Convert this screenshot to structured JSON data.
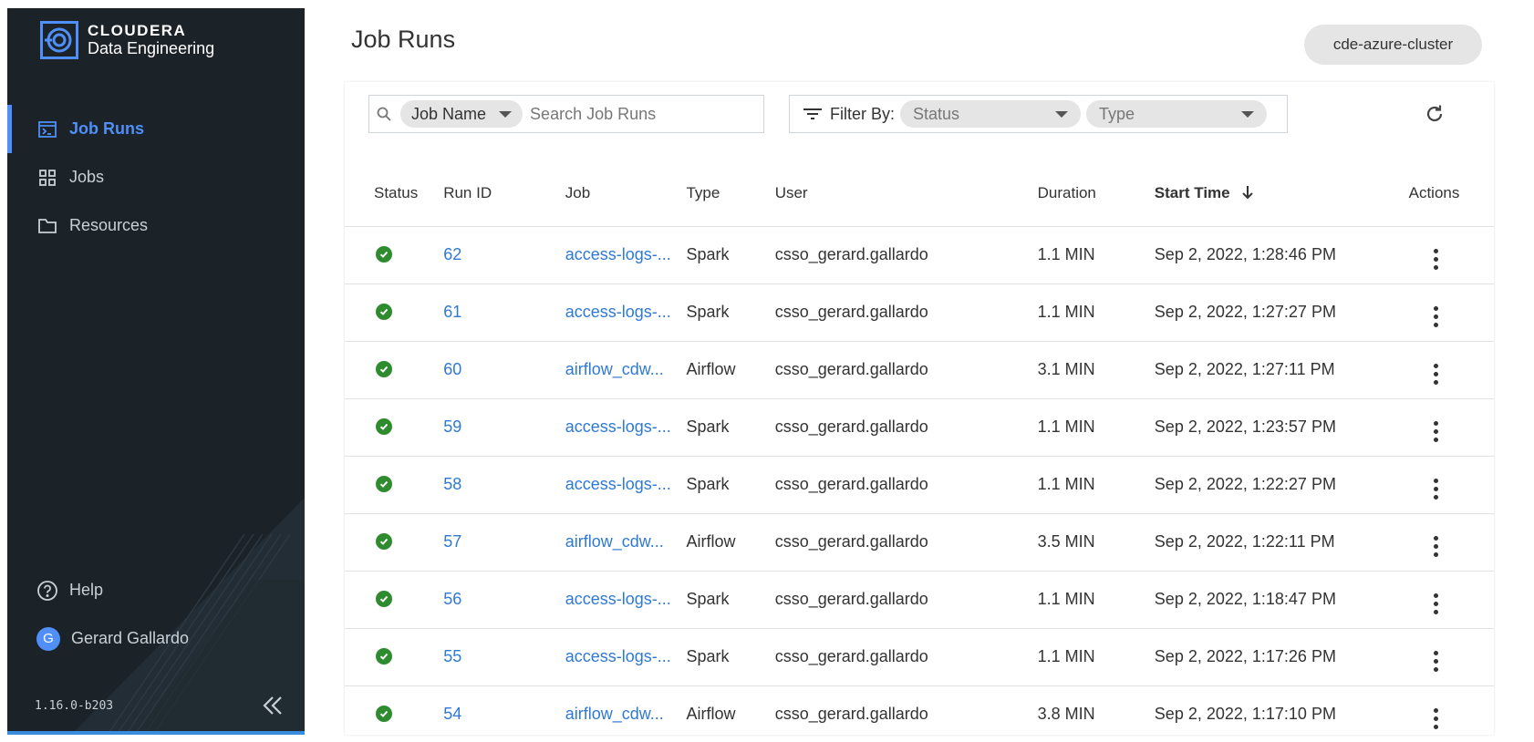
{
  "brand": {
    "line1": "CLOUDERA",
    "line2": "Data Engineering"
  },
  "sidebar": {
    "items": [
      {
        "label": "Job Runs",
        "icon": "job-runs-icon",
        "active": true
      },
      {
        "label": "Jobs",
        "icon": "grid-icon",
        "active": false
      },
      {
        "label": "Resources",
        "icon": "folder-icon",
        "active": false
      }
    ],
    "help_label": "Help",
    "user": {
      "initial": "G",
      "name": "Gerard Gallardo"
    },
    "version": "1.16.0-b203",
    "accent_color": "#4f8ff7",
    "background_color": "#1b2329"
  },
  "header": {
    "title": "Job Runs",
    "cluster": "cde-azure-cluster"
  },
  "toolbar": {
    "search_field": "Job Name",
    "search_placeholder": "Search Job Runs",
    "filter_label": "Filter By:",
    "status_placeholder": "Status",
    "type_placeholder": "Type"
  },
  "table": {
    "headers": {
      "status": "Status",
      "run_id": "Run ID",
      "job": "Job",
      "type": "Type",
      "user": "User",
      "duration": "Duration",
      "start_time": "Start Time",
      "actions": "Actions"
    },
    "sorted_by": "start_time",
    "sort_direction": "descending",
    "rows": [
      {
        "status": "success",
        "run_id": "62",
        "job": "access-logs-...",
        "type": "Spark",
        "user": "csso_gerard.gallardo",
        "duration": "1.1 MIN",
        "start_time": "Sep 2, 2022, 1:28:46 PM"
      },
      {
        "status": "success",
        "run_id": "61",
        "job": "access-logs-...",
        "type": "Spark",
        "user": "csso_gerard.gallardo",
        "duration": "1.1 MIN",
        "start_time": "Sep 2, 2022, 1:27:27 PM"
      },
      {
        "status": "success",
        "run_id": "60",
        "job": "airflow_cdw...",
        "type": "Airflow",
        "user": "csso_gerard.gallardo",
        "duration": "3.1 MIN",
        "start_time": "Sep 2, 2022, 1:27:11 PM"
      },
      {
        "status": "success",
        "run_id": "59",
        "job": "access-logs-...",
        "type": "Spark",
        "user": "csso_gerard.gallardo",
        "duration": "1.1 MIN",
        "start_time": "Sep 2, 2022, 1:23:57 PM"
      },
      {
        "status": "success",
        "run_id": "58",
        "job": "access-logs-...",
        "type": "Spark",
        "user": "csso_gerard.gallardo",
        "duration": "1.1 MIN",
        "start_time": "Sep 2, 2022, 1:22:27 PM"
      },
      {
        "status": "success",
        "run_id": "57",
        "job": "airflow_cdw...",
        "type": "Airflow",
        "user": "csso_gerard.gallardo",
        "duration": "3.5 MIN",
        "start_time": "Sep 2, 2022, 1:22:11 PM"
      },
      {
        "status": "success",
        "run_id": "56",
        "job": "access-logs-...",
        "type": "Spark",
        "user": "csso_gerard.gallardo",
        "duration": "1.1 MIN",
        "start_time": "Sep 2, 2022, 1:18:47 PM"
      },
      {
        "status": "success",
        "run_id": "55",
        "job": "access-logs-...",
        "type": "Spark",
        "user": "csso_gerard.gallardo",
        "duration": "1.1 MIN",
        "start_time": "Sep 2, 2022, 1:17:26 PM"
      },
      {
        "status": "success",
        "run_id": "54",
        "job": "airflow_cdw...",
        "type": "Airflow",
        "user": "csso_gerard.gallardo",
        "duration": "3.8 MIN",
        "start_time": "Sep 2, 2022, 1:17:10 PM"
      }
    ]
  },
  "colors": {
    "link": "#2f79d6",
    "success": "#2e8b2e"
  }
}
